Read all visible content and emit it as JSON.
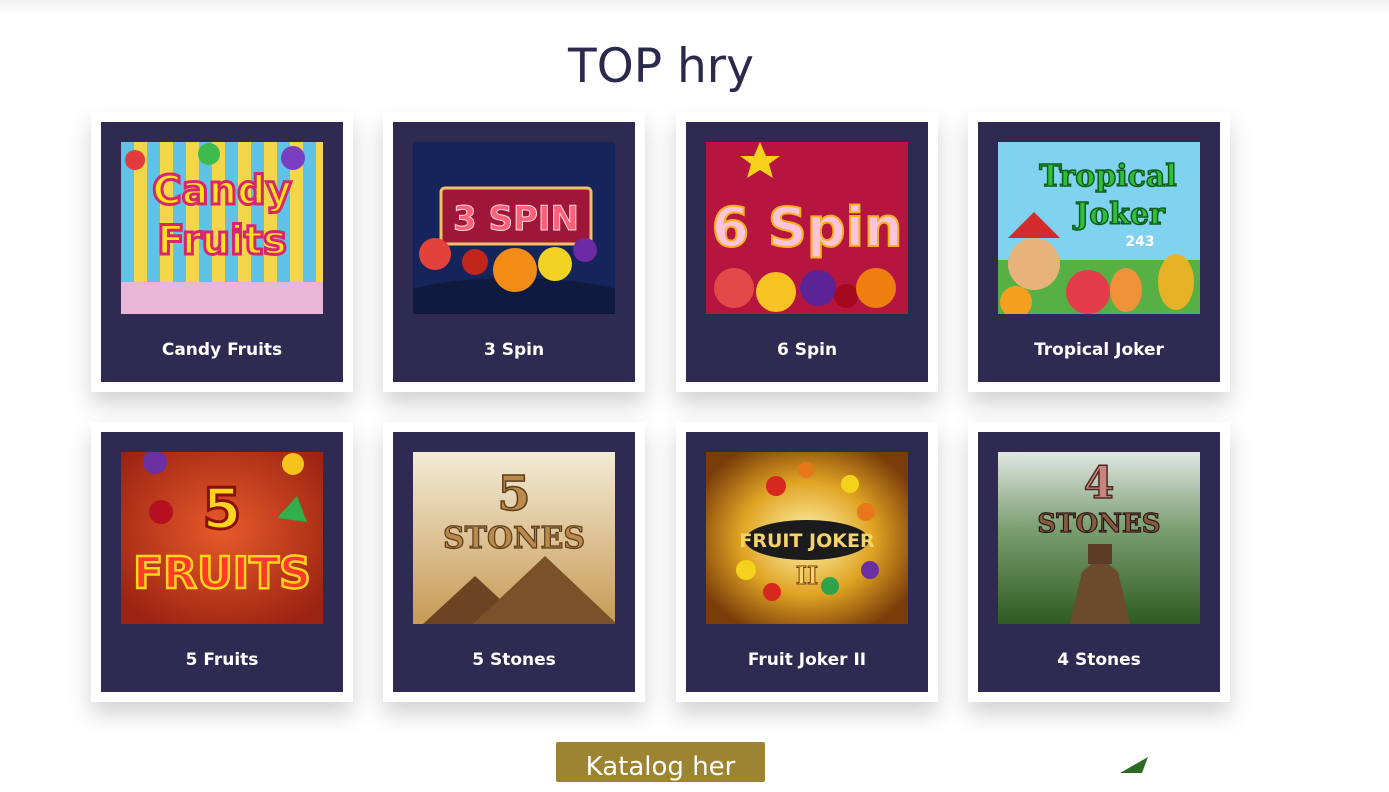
{
  "header": {
    "title": "TOP hry"
  },
  "games": [
    {
      "name": "Candy Fruits",
      "art_line1": "Candy",
      "art_line2": "Fruits"
    },
    {
      "name": "3 Spin",
      "art_line1": "3 SPIN",
      "art_line2": ""
    },
    {
      "name": "6 Spin",
      "art_line1": "6 Spin",
      "art_line2": ""
    },
    {
      "name": "Tropical Joker",
      "art_line1": "Tropical",
      "art_line2": "Joker",
      "art_line3": "243"
    },
    {
      "name": "5 Fruits",
      "art_line1": "5",
      "art_line2": "FRUITS"
    },
    {
      "name": "5 Stones",
      "art_line1": "5",
      "art_line2": "STONES"
    },
    {
      "name": "Fruit Joker II",
      "art_line1": "FRUIT JOKER",
      "art_line2": "II"
    },
    {
      "name": "4 Stones",
      "art_line1": "4",
      "art_line2": "STONES"
    }
  ],
  "catalog_button": {
    "label": "Katalog her"
  },
  "colors": {
    "card_background": "#2f2a52",
    "button": "#9c8433",
    "title": "#2b2a4c"
  }
}
